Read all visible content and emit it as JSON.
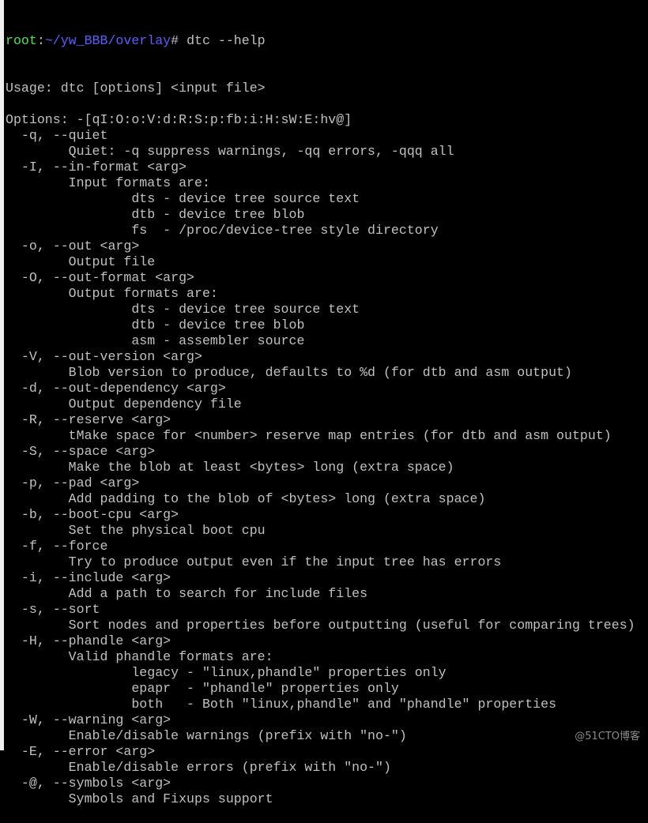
{
  "prompt": {
    "user": "root",
    "sep1": ":",
    "path": "~/yw_BBB/overlay",
    "sep2": "# ",
    "command": "dtc --help"
  },
  "colors": {
    "background": "#000000",
    "text": "#c0c0c0",
    "prompt_user": "#4ce44c",
    "prompt_path": "#5c5cff"
  },
  "output_lines": [
    "Usage: dtc [options] <input file>",
    "",
    "Options: -[qI:O:o:V:d:R:S:p:fb:i:H:sW:E:hv@]",
    "  -q, --quiet",
    "        Quiet: -q suppress warnings, -qq errors, -qqq all",
    "  -I, --in-format <arg>",
    "        Input formats are:",
    "                dts - device tree source text",
    "                dtb - device tree blob",
    "                fs  - /proc/device-tree style directory",
    "  -o, --out <arg>",
    "        Output file",
    "  -O, --out-format <arg>",
    "        Output formats are:",
    "                dts - device tree source text",
    "                dtb - device tree blob",
    "                asm - assembler source",
    "  -V, --out-version <arg>",
    "        Blob version to produce, defaults to %d (for dtb and asm output)",
    "  -d, --out-dependency <arg>",
    "        Output dependency file",
    "  -R, --reserve <arg>",
    "        tMake space for <number> reserve map entries (for dtb and asm output)",
    "  -S, --space <arg>",
    "        Make the blob at least <bytes> long (extra space)",
    "  -p, --pad <arg>",
    "        Add padding to the blob of <bytes> long (extra space)",
    "  -b, --boot-cpu <arg>",
    "        Set the physical boot cpu",
    "  -f, --force",
    "        Try to produce output even if the input tree has errors",
    "  -i, --include <arg>",
    "        Add a path to search for include files",
    "  -s, --sort",
    "        Sort nodes and properties before outputting (useful for comparing trees)",
    "  -H, --phandle <arg>",
    "        Valid phandle formats are:",
    "                legacy - \"linux,phandle\" properties only",
    "                epapr  - \"phandle\" properties only",
    "                both   - Both \"linux,phandle\" and \"phandle\" properties",
    "  -W, --warning <arg>",
    "        Enable/disable warnings (prefix with \"no-\")",
    "  -E, --error <arg>",
    "        Enable/disable errors (prefix with \"no-\")",
    "  -@, --symbols <arg>",
    "        Symbols and Fixups support"
  ],
  "watermark": "@51CTO博客"
}
